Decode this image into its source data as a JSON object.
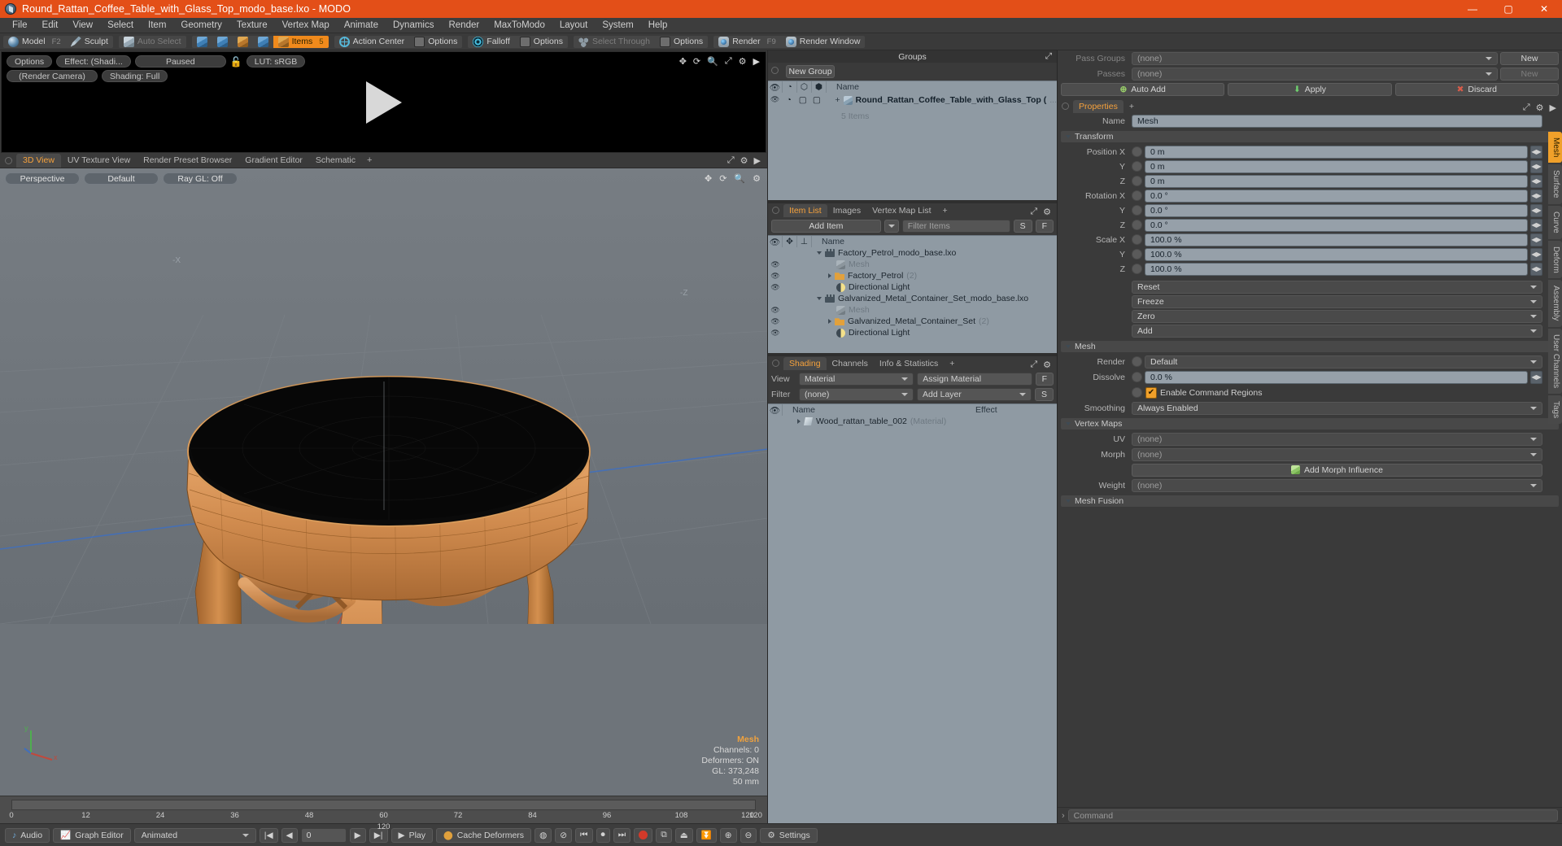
{
  "window": {
    "title": "Round_Rattan_Coffee_Table_with_Glass_Top_modo_base.lxo - MODO",
    "minimize": "—",
    "maximize": "▢",
    "close": "✕"
  },
  "menubar": {
    "items": [
      "File",
      "Edit",
      "View",
      "Select",
      "Item",
      "Geometry",
      "Texture",
      "Vertex Map",
      "Animate",
      "Dynamics",
      "Render",
      "MaxToModo",
      "Layout",
      "System",
      "Help"
    ]
  },
  "modebar": {
    "model": "Model",
    "model_key": "F2",
    "sculpt": "Sculpt",
    "auto_select": "Auto Select",
    "items": "Items",
    "items_key": "5",
    "action_center": "Action Center",
    "options1": "Options",
    "falloff": "Falloff",
    "options2": "Options",
    "select_through": "Select Through",
    "options3": "Options",
    "render": "Render",
    "render_key": "F9",
    "render_window": "Render Window"
  },
  "preview": {
    "options": "Options",
    "effect": "Effect: (Shadi...",
    "paused": "Paused",
    "lut": "LUT: sRGB",
    "render_camera": "(Render Camera)",
    "shading": "Shading: Full"
  },
  "viewport_tabs": {
    "tabs": [
      "3D View",
      "UV Texture View",
      "Render Preset Browser",
      "Gradient Editor",
      "Schematic"
    ],
    "active": "3D View",
    "plus": "+"
  },
  "viewport": {
    "perspective": "Perspective",
    "preset": "Default",
    "raygl": "Ray GL: Off",
    "axis_x": "-X",
    "axis_z": "-Z",
    "gizmo_y": "y",
    "gizmo_x": "x",
    "stats_title": "Mesh",
    "stats": [
      {
        "label": "Channels:",
        "value": "0"
      },
      {
        "label": "Deformers:",
        "value": "ON"
      },
      {
        "label": "GL:",
        "value": "373,248"
      }
    ],
    "scale": "50 mm"
  },
  "timeline": {
    "ticks": [
      "0",
      "12",
      "24",
      "36",
      "48",
      "60",
      "72",
      "84",
      "96",
      "108",
      "120"
    ],
    "center": "120",
    "end": "120"
  },
  "groups": {
    "panel_title": "Groups",
    "new_group": "New Group",
    "col_name": "Name",
    "rows": [
      {
        "name": "Round_Rattan_Coffee_Table_with_Glass_Top (",
        "sub": "5 Items",
        "ellipsis": "..."
      }
    ]
  },
  "itemlist": {
    "tabs": [
      "Item List",
      "Images",
      "Vertex Map List"
    ],
    "active": "Item List",
    "plus": "+",
    "add_item": "Add Item",
    "filter_placeholder": "Filter Items",
    "btn_s": "S",
    "btn_f": "F",
    "col_name": "Name",
    "rows": [
      {
        "indent": 0,
        "icon": "film-icon",
        "label": "Factory_Petrol_modo_base.lxo",
        "count": "",
        "dim": false,
        "expander": "down",
        "eye": false
      },
      {
        "indent": 1,
        "icon": "mesh-cube-icon",
        "label": "Mesh",
        "count": "",
        "dim": true,
        "expander": "none",
        "eye": true
      },
      {
        "indent": 1,
        "icon": "folder-icon",
        "label": "Factory_Petrol",
        "count": "(2)",
        "dim": false,
        "expander": "right",
        "eye": true
      },
      {
        "indent": 1,
        "icon": "light-icon",
        "label": "Directional Light",
        "count": "",
        "dim": false,
        "expander": "none",
        "eye": true
      },
      {
        "indent": 0,
        "icon": "film-icon",
        "label": "Galvanized_Metal_Container_Set_modo_base.lxo",
        "count": "",
        "dim": false,
        "expander": "down",
        "eye": false
      },
      {
        "indent": 1,
        "icon": "mesh-cube-icon",
        "label": "Mesh",
        "count": "",
        "dim": true,
        "expander": "none",
        "eye": true
      },
      {
        "indent": 1,
        "icon": "folder-icon",
        "label": "Galvanized_Metal_Container_Set",
        "count": "(2)",
        "dim": false,
        "expander": "right",
        "eye": true
      },
      {
        "indent": 1,
        "icon": "light-icon",
        "label": "Directional Light",
        "count": "",
        "dim": false,
        "expander": "none",
        "eye": true
      }
    ]
  },
  "shading": {
    "tabs": [
      "Shading",
      "Channels",
      "Info & Statistics"
    ],
    "active": "Shading",
    "plus": "+",
    "view_label": "View",
    "view_value": "Material",
    "assign_material": "Assign Material",
    "btn_f": "F",
    "filter_label": "Filter",
    "filter_value": "(none)",
    "add_layer": "Add Layer",
    "btn_s": "S",
    "col_name": "Name",
    "col_effect": "Effect",
    "rows": [
      {
        "label": "Wood_rattan_table_002",
        "type": "(Material)",
        "effect": ""
      }
    ]
  },
  "properties": {
    "pass_groups_label": "Pass Groups",
    "pass_groups_value": "(none)",
    "pass_groups_new": "New",
    "passes_label": "Passes",
    "passes_value": "(none)",
    "passes_new": "New",
    "auto_add": "Auto Add",
    "apply": "Apply",
    "discard": "Discard",
    "tabs": [
      "Properties"
    ],
    "active": "Properties",
    "plus": "+",
    "name_label": "Name",
    "name_value": "Mesh",
    "transform_section": "Transform",
    "transform_rows": [
      {
        "label": "Position X",
        "value": "0 m"
      },
      {
        "label": "Y",
        "value": "0 m"
      },
      {
        "label": "Z",
        "value": "0 m"
      },
      {
        "label": "Rotation X",
        "value": "0.0 °"
      },
      {
        "label": "Y",
        "value": "0.0 °"
      },
      {
        "label": "Z",
        "value": "0.0 °"
      },
      {
        "label": "Scale X",
        "value": "100.0 %"
      },
      {
        "label": "Y",
        "value": "100.0 %"
      },
      {
        "label": "Z",
        "value": "100.0 %"
      }
    ],
    "actions": [
      "Reset",
      "Freeze",
      "Zero",
      "Add"
    ],
    "mesh_section": "Mesh",
    "render_label": "Render",
    "render_value": "Default",
    "dissolve_label": "Dissolve",
    "dissolve_value": "0.0 %",
    "enable_command_regions": "Enable Command Regions",
    "smoothing_label": "Smoothing",
    "smoothing_value": "Always Enabled",
    "vertex_maps_section": "Vertex Maps",
    "uv_label": "UV",
    "uv_value": "(none)",
    "morph_label": "Morph",
    "morph_value": "(none)",
    "add_morph_influence": "Add Morph Influence",
    "weight_label": "Weight",
    "weight_value": "(none)",
    "mesh_fusion_section": "Mesh Fusion",
    "side_tabs": [
      "Mesh",
      "Surface",
      "Curve",
      "Deform",
      "Assembly",
      "User Channels",
      "Tags"
    ],
    "side_active": "Mesh",
    "command_placeholder": "Command"
  },
  "bottombar": {
    "audio": "Audio",
    "graph_editor": "Graph Editor",
    "animated": "Animated",
    "frame": "0",
    "play": "Play",
    "cache_deformers": "Cache Deformers",
    "settings": "Settings"
  },
  "colors": {
    "accent": "#e34f18",
    "tab_active": "#f5a13c",
    "panel": "#3a3a3a",
    "list": "#8f9aa3"
  }
}
